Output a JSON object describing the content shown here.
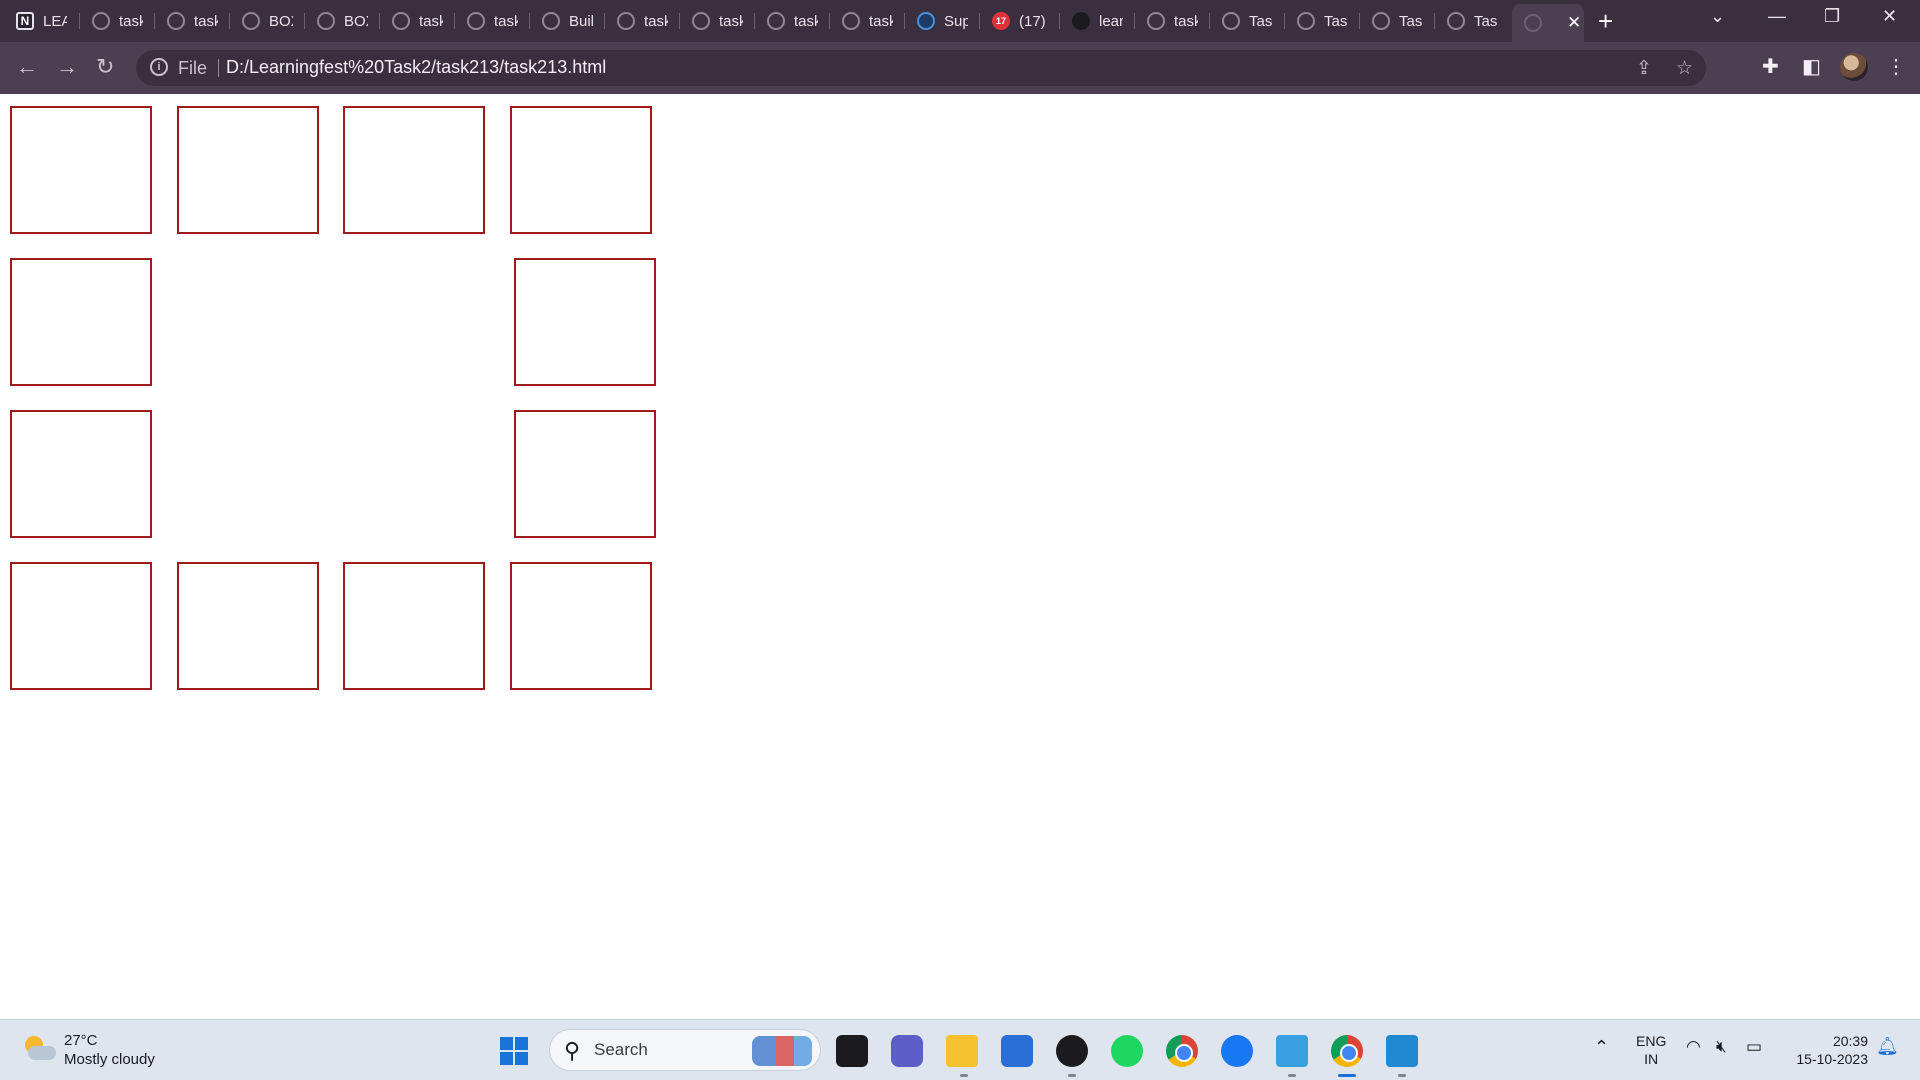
{
  "browser": {
    "tabs": [
      {
        "label": "LEA"
      },
      {
        "label": "task"
      },
      {
        "label": "task"
      },
      {
        "label": "BOX"
      },
      {
        "label": "BOX"
      },
      {
        "label": "task"
      },
      {
        "label": "task"
      },
      {
        "label": "Buil"
      },
      {
        "label": "task"
      },
      {
        "label": "task"
      },
      {
        "label": "task"
      },
      {
        "label": "task"
      },
      {
        "label": "Sup"
      },
      {
        "label": "(17)"
      },
      {
        "label": "lear"
      },
      {
        "label": "task"
      },
      {
        "label": "Task"
      },
      {
        "label": "Task"
      },
      {
        "label": "Task"
      },
      {
        "label": "Task"
      }
    ],
    "active_tab_close": "✕",
    "new_tab": "+",
    "address": {
      "scheme_label": "File",
      "url": "D:/Learningfest%20Task2/task213/task213.html"
    },
    "youtube_badge": "17",
    "notion_glyph": "N"
  },
  "page": {
    "box_border_color": "#a01a1a",
    "boxes_top_row": 4,
    "boxes_middle_rows": 2,
    "boxes_bottom_row": 4
  },
  "taskbar": {
    "weather": {
      "temp": "27°C",
      "desc": "Mostly cloudy"
    },
    "search_label": "Search",
    "lang": {
      "line1": "ENG",
      "line2": "IN"
    },
    "time": "20:39",
    "date": "15-10-2023"
  }
}
